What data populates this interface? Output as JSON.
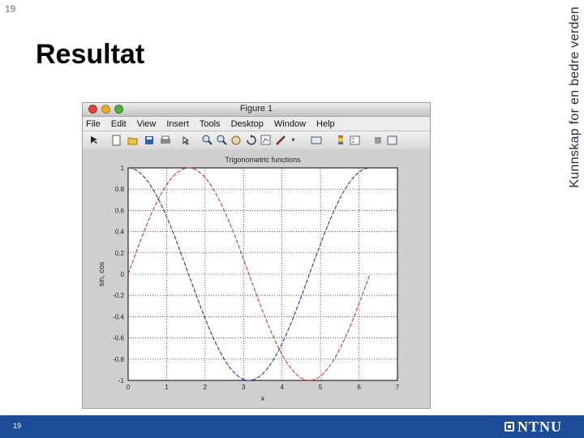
{
  "slide": {
    "number_top": "19",
    "title": "Resultat",
    "number_bottom": "19",
    "tagline": "Kunnskap for en bedre verden",
    "logo_text": "NTNU"
  },
  "window": {
    "title": "Figure 1",
    "menu": [
      "File",
      "Edit",
      "View",
      "Insert",
      "Tools",
      "Desktop",
      "Window",
      "Help"
    ],
    "toolbar_icons": [
      "pointer-arrow-icon",
      "new-figure-icon",
      "open-file-icon",
      "save-icon",
      "print-icon",
      "edit-plot-icon",
      "zoom-in-icon",
      "zoom-out-icon",
      "pan-icon",
      "rotate-3d-icon",
      "data-cursor-icon",
      "brush-icon",
      "link-plot-icon",
      "insert-colorbar-icon",
      "insert-legend-icon",
      "hide-plot-tools-icon",
      "show-plot-tools-icon"
    ]
  },
  "chart_data": {
    "type": "line",
    "title": "Trigonometric functions",
    "xlabel": "x",
    "ylabel": "sin, cos",
    "xlim": [
      0,
      7
    ],
    "ylim": [
      -1,
      1
    ],
    "xticks": [
      "0",
      "1",
      "2",
      "3",
      "4",
      "5",
      "6",
      "7"
    ],
    "yticks": [
      "1",
      "0.8",
      "0.6",
      "0.4",
      "0.2",
      "0",
      "-0.2",
      "-0.4",
      "-0.6",
      "-0.8",
      "-1"
    ],
    "grid": true,
    "series": [
      {
        "function": "cos",
        "color": "#1a1aa8",
        "style": "dashed",
        "x_range": [
          0,
          6.28
        ]
      },
      {
        "function": "sin",
        "color": "#c0282d",
        "style": "dashed",
        "x_range": [
          0,
          6.28
        ]
      }
    ]
  },
  "colors": {
    "bottom_bar": "#1c4c97",
    "cos_line": "#1a1aa8",
    "sin_line": "#c0282d"
  }
}
